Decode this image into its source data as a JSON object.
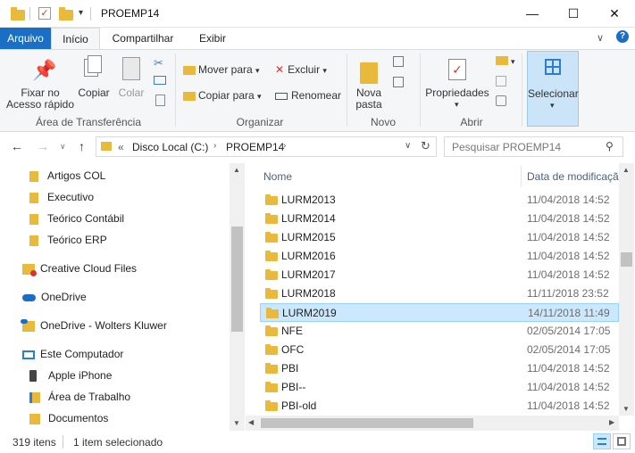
{
  "window": {
    "title": "PROEMP14",
    "minimize_glyph": "—",
    "maximize_glyph": "☐",
    "close_glyph": "✕"
  },
  "ribbon_tabs": {
    "file": "Arquivo",
    "home": "Início",
    "share": "Compartilhar",
    "view": "Exibir"
  },
  "ribbon": {
    "pin_label_1": "Fixar no",
    "pin_label_2": "Acesso rápido",
    "copy": "Copiar",
    "paste": "Colar",
    "clipboard_group": "Área de Transferência",
    "move_to": "Mover para",
    "copy_to": "Copiar para",
    "delete": "Excluir",
    "rename": "Renomear",
    "organize_group": "Organizar",
    "new_folder_1": "Nova",
    "new_folder_2": "pasta",
    "new_group": "Novo",
    "properties": "Propriedades",
    "open_group": "Abrir",
    "select": "Selecionar"
  },
  "address": {
    "prefix": "«",
    "segments": [
      "Disco Local (C:)",
      "PROEMP14"
    ],
    "search_placeholder": "Pesquisar PROEMP14"
  },
  "nav_pane": {
    "items": [
      {
        "label": "Artigos COL",
        "icon": "folder-icon"
      },
      {
        "label": "Executivo",
        "icon": "folder-icon"
      },
      {
        "label": "Teórico Contábil",
        "icon": "folder-icon"
      },
      {
        "label": "Teórico ERP",
        "icon": "folder-icon"
      },
      {
        "label": "Creative Cloud Files",
        "icon": "creative-cloud-icon"
      },
      {
        "label": "OneDrive",
        "icon": "onedrive-icon"
      },
      {
        "label": "OneDrive - Wolters Kluwer",
        "icon": "onedrive-business-icon"
      },
      {
        "label": "Este Computador",
        "icon": "computer-icon"
      },
      {
        "label": "Apple iPhone",
        "icon": "phone-icon"
      },
      {
        "label": "Área de Trabalho",
        "icon": "desktop-folder-icon"
      },
      {
        "label": "Documentos",
        "icon": "documents-folder-icon"
      }
    ]
  },
  "file_list": {
    "columns": [
      "Nome",
      "Data de modificaçã"
    ],
    "rows": [
      {
        "name": "LURM2013",
        "date": "11/04/2018 14:52",
        "selected": false
      },
      {
        "name": "LURM2014",
        "date": "11/04/2018 14:52",
        "selected": false
      },
      {
        "name": "LURM2015",
        "date": "11/04/2018 14:52",
        "selected": false
      },
      {
        "name": "LURM2016",
        "date": "11/04/2018 14:52",
        "selected": false
      },
      {
        "name": "LURM2017",
        "date": "11/04/2018 14:52",
        "selected": false
      },
      {
        "name": "LURM2018",
        "date": "11/11/2018 23:52",
        "selected": false
      },
      {
        "name": "LURM2019",
        "date": "14/11/2018 11:49",
        "selected": true
      },
      {
        "name": "NFE",
        "date": "02/05/2014 17:05",
        "selected": false
      },
      {
        "name": "OFC",
        "date": "02/05/2014 17:05",
        "selected": false
      },
      {
        "name": "PBI",
        "date": "11/04/2018 14:52",
        "selected": false
      },
      {
        "name": "PBI--",
        "date": "11/04/2018 14:52",
        "selected": false
      },
      {
        "name": "PBI-old",
        "date": "11/04/2018 14:52",
        "selected": false
      }
    ]
  },
  "status": {
    "items_count": "319 itens",
    "selected_count": "1 item selecionado"
  },
  "colors": {
    "accent": "#1a6fc4",
    "folder": "#e8b93a",
    "selection": "#cce8ff"
  }
}
